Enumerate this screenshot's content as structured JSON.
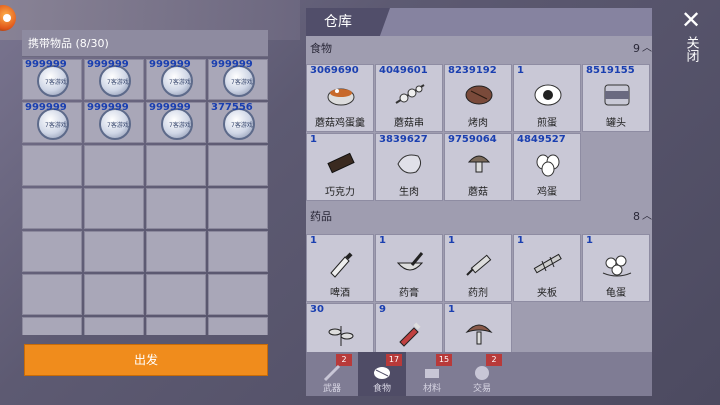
{
  "inventory": {
    "header": "携带物品 (8/30)",
    "slots": [
      {
        "count": "999999",
        "label": "7客游戏"
      },
      {
        "count": "999999",
        "label": "7客游戏"
      },
      {
        "count": "999999",
        "label": "7客游戏"
      },
      {
        "count": "999999",
        "label": "7客游戏"
      },
      {
        "count": "999999",
        "label": "7客游戏"
      },
      {
        "count": "999999",
        "label": "7客游戏"
      },
      {
        "count": "999999",
        "label": "7客游戏"
      },
      {
        "count": "377556",
        "label": "7客游戏"
      }
    ],
    "depart_label": "出发"
  },
  "warehouse": {
    "title": "仓库",
    "food": {
      "heading": "食物",
      "count": "9",
      "items": [
        {
          "qty": "3069690",
          "name": "蘑菇鸡蛋羹",
          "icon": "soup-bowl-icon"
        },
        {
          "qty": "4049601",
          "name": "蘑菇串",
          "icon": "skewer-icon"
        },
        {
          "qty": "8239192",
          "name": "烤肉",
          "icon": "roast-meat-icon"
        },
        {
          "qty": "1",
          "name": "煎蛋",
          "icon": "fried-egg-icon"
        },
        {
          "qty": "8519155",
          "name": "罐头",
          "icon": "canned-food-icon"
        },
        {
          "qty": "1",
          "name": "巧克力",
          "icon": "chocolate-icon"
        },
        {
          "qty": "3839627",
          "name": "生肉",
          "icon": "raw-meat-icon"
        },
        {
          "qty": "9759064",
          "name": "蘑菇",
          "icon": "mushroom-icon"
        },
        {
          "qty": "4849527",
          "name": "鸡蛋",
          "icon": "eggs-icon"
        }
      ]
    },
    "medicine": {
      "heading": "药品",
      "count": "8",
      "items": [
        {
          "qty": "1",
          "name": "啤酒",
          "icon": "beer-bottle-icon"
        },
        {
          "qty": "1",
          "name": "药膏",
          "icon": "mortar-icon"
        },
        {
          "qty": "1",
          "name": "药剂",
          "icon": "injection-icon"
        },
        {
          "qty": "1",
          "name": "夹板",
          "icon": "splint-icon"
        },
        {
          "qty": "1",
          "name": "龟蛋",
          "icon": "turtle-eggs-icon"
        },
        {
          "qty": "30",
          "name": "",
          "icon": "herb-icon"
        },
        {
          "qty": "9",
          "name": "",
          "icon": "soda-bottle-icon"
        },
        {
          "qty": "1",
          "name": "",
          "icon": "fungus-icon"
        }
      ]
    },
    "tabs": [
      {
        "label": "武器",
        "badge": "2",
        "icon": "weapon-icon"
      },
      {
        "label": "食物",
        "badge": "17",
        "icon": "food-icon"
      },
      {
        "label": "材料",
        "badge": "15",
        "icon": "material-icon"
      },
      {
        "label": "交易",
        "badge": "2",
        "icon": "trade-icon"
      }
    ]
  },
  "close_label": "关闭",
  "colors": {
    "accent": "#f08c1c",
    "count_blue": "#1a3fb0",
    "panel": "#9f9db0"
  }
}
